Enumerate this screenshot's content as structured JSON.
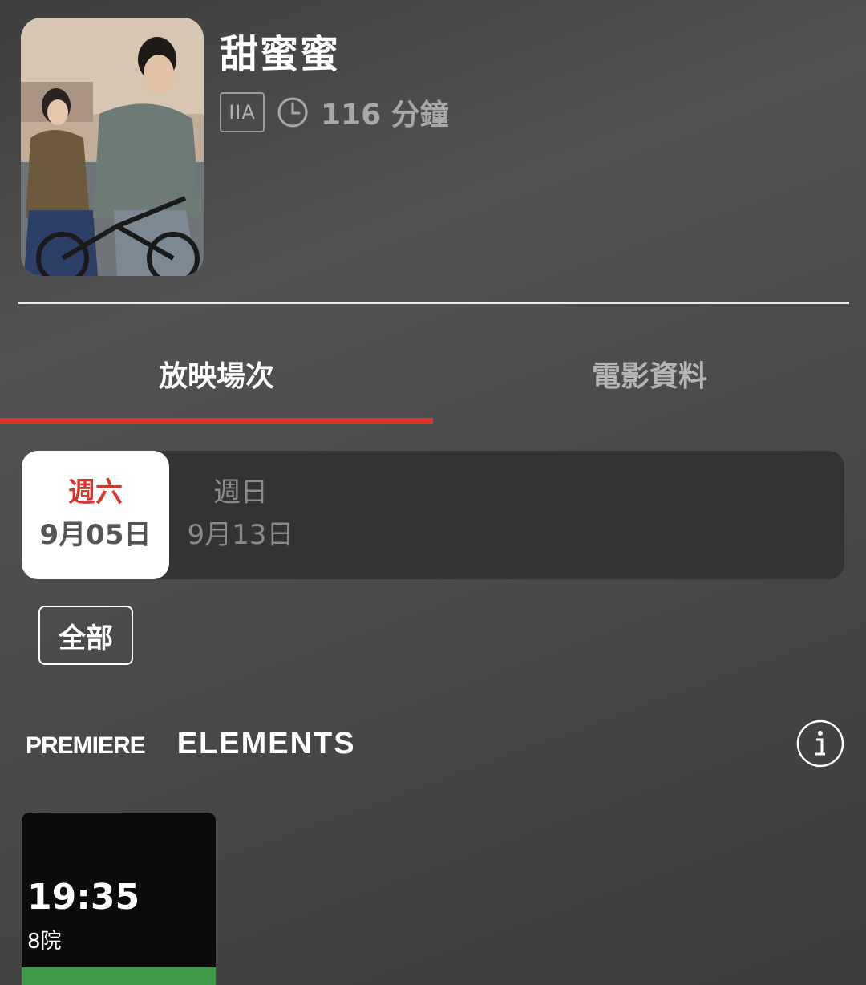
{
  "movie": {
    "title": "甜蜜蜜",
    "rating": "IIA",
    "duration": "116 分鐘"
  },
  "tabs": [
    {
      "label": "放映場次",
      "active": true
    },
    {
      "label": "電影資料",
      "active": false
    }
  ],
  "dates": [
    {
      "day": "週六",
      "date": "9月05日",
      "selected": true
    },
    {
      "day": "週日",
      "date": "9月13日",
      "selected": false
    }
  ],
  "filter": {
    "label": "全部"
  },
  "cinema": {
    "logo_part1": "PREMIERE",
    "logo_part2": "ELEMENTS",
    "info_icon": "info-icon"
  },
  "showtimes": [
    {
      "time": "19:35",
      "house": "8院",
      "availability": 1.0
    }
  ],
  "colors": {
    "accent": "#e0342b",
    "available": "#3f9a4a",
    "background": "#4a4a4a"
  }
}
